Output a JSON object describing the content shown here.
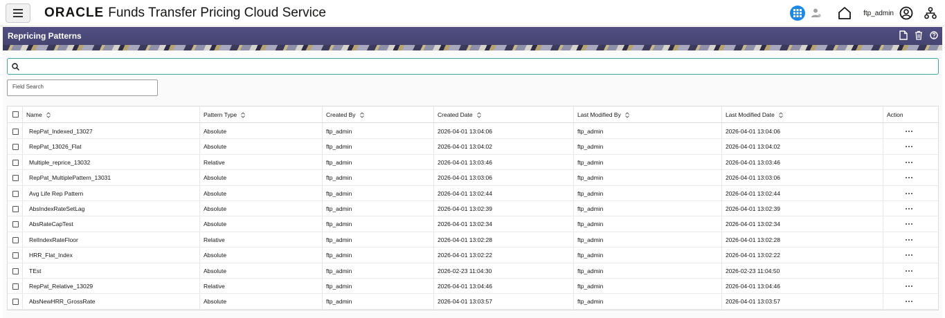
{
  "header": {
    "brand_logo": "ORACLE",
    "brand_title": "Funds Transfer Pricing Cloud Service",
    "user_name": "ftp_admin",
    "accent_color": "#1e88e5"
  },
  "page": {
    "title": "Repricing Patterns",
    "title_bar_color": "#4c4a7a"
  },
  "search": {
    "placeholder": "",
    "field_search_label": "Field Search"
  },
  "table": {
    "columns": [
      "Name",
      "Pattern Type",
      "Created By",
      "Created Date",
      "Last Modified By",
      "Last Modified Date",
      "Action"
    ],
    "rows": [
      {
        "name": "RepPat_Indexed_13027",
        "type": "Absolute",
        "created_by": "ftp_admin",
        "created_date": "2026-04-01 13:04:06",
        "modified_by": "ftp_admin",
        "modified_date": "2026-04-01 13:04:06"
      },
      {
        "name": "RepPat_13026_Flat",
        "type": "Absolute",
        "created_by": "ftp_admin",
        "created_date": "2026-04-01 13:04:02",
        "modified_by": "ftp_admin",
        "modified_date": "2026-04-01 13:04:02"
      },
      {
        "name": "Multiple_reprice_13032",
        "type": "Relative",
        "created_by": "ftp_admin",
        "created_date": "2026-04-01 13:03:46",
        "modified_by": "ftp_admin",
        "modified_date": "2026-04-01 13:03:46"
      },
      {
        "name": "RepPat_MultiplePattern_13031",
        "type": "Absolute",
        "created_by": "ftp_admin",
        "created_date": "2026-04-01 13:03:06",
        "modified_by": "ftp_admin",
        "modified_date": "2026-04-01 13:03:06"
      },
      {
        "name": "Avg Life Rep Pattern",
        "type": "Absolute",
        "created_by": "ftp_admin",
        "created_date": "2026-04-01 13:02:44",
        "modified_by": "ftp_admin",
        "modified_date": "2026-04-01 13:02:44"
      },
      {
        "name": "AbsIndexRateSetLag",
        "type": "Absolute",
        "created_by": "ftp_admin",
        "created_date": "2026-04-01 13:02:39",
        "modified_by": "ftp_admin",
        "modified_date": "2026-04-01 13:02:39"
      },
      {
        "name": "AbsRateCapTest",
        "type": "Absolute",
        "created_by": "ftp_admin",
        "created_date": "2026-04-01 13:02:34",
        "modified_by": "ftp_admin",
        "modified_date": "2026-04-01 13:02:34"
      },
      {
        "name": "RelIndexRateFloor",
        "type": "Relative",
        "created_by": "ftp_admin",
        "created_date": "2026-04-01 13:02:28",
        "modified_by": "ftp_admin",
        "modified_date": "2026-04-01 13:02:28"
      },
      {
        "name": "HRR_Flat_Index",
        "type": "Absolute",
        "created_by": "ftp_admin",
        "created_date": "2026-04-01 13:02:22",
        "modified_by": "ftp_admin",
        "modified_date": "2026-04-01 13:02:22"
      },
      {
        "name": "TEst",
        "type": "Absolute",
        "created_by": "ftp_admin",
        "created_date": "2026-02-23 11:04:30",
        "modified_by": "ftp_admin",
        "modified_date": "2026-02-23 11:04:50"
      },
      {
        "name": "RepPat_Relative_13029",
        "type": "Relative",
        "created_by": "ftp_admin",
        "created_date": "2026-04-01 13:04:46",
        "modified_by": "ftp_admin",
        "modified_date": "2026-04-01 13:04:46"
      },
      {
        "name": "AbsNewHRR_GrossRate",
        "type": "Absolute",
        "created_by": "ftp_admin",
        "created_date": "2026-04-01 13:03:57",
        "modified_by": "ftp_admin",
        "modified_date": "2026-04-01 13:03:57"
      }
    ]
  }
}
